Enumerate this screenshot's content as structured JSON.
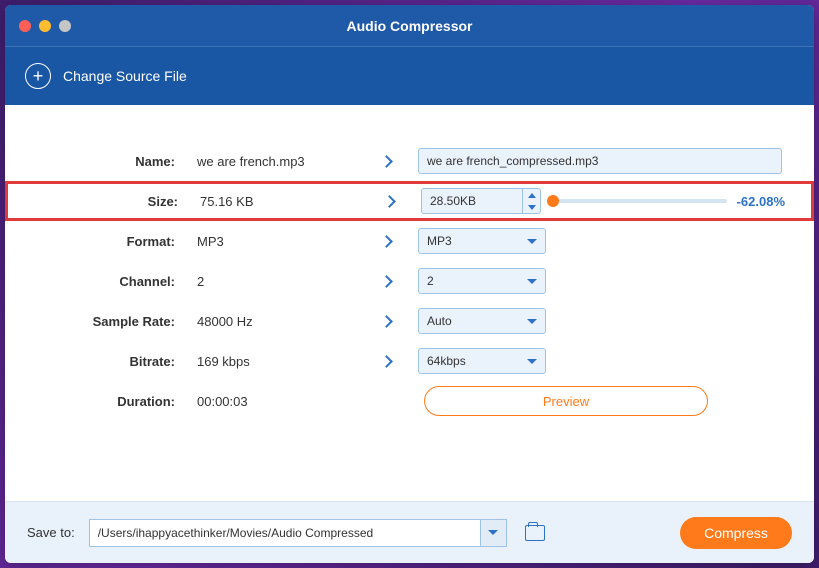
{
  "window": {
    "title": "Audio Compressor",
    "change_source": "Change Source File"
  },
  "fields": {
    "name": {
      "label": "Name:",
      "source": "we are french.mp3",
      "target": "we are french_compressed.mp3"
    },
    "size": {
      "label": "Size:",
      "source": "75.16 KB",
      "target": "28.50KB",
      "percent": "-62.08%"
    },
    "format": {
      "label": "Format:",
      "source": "MP3",
      "target": "MP3"
    },
    "channel": {
      "label": "Channel:",
      "source": "2",
      "target": "2"
    },
    "sample_rate": {
      "label": "Sample Rate:",
      "source": "48000 Hz",
      "target": "Auto"
    },
    "bitrate": {
      "label": "Bitrate:",
      "source": "169 kbps",
      "target": "64kbps"
    },
    "duration": {
      "label": "Duration:",
      "value": "00:00:03"
    }
  },
  "preview_label": "Preview",
  "footer": {
    "save_to_label": "Save to:",
    "path": "/Users/ihappyacethinker/Movies/Audio Compressed",
    "compress_label": "Compress"
  }
}
